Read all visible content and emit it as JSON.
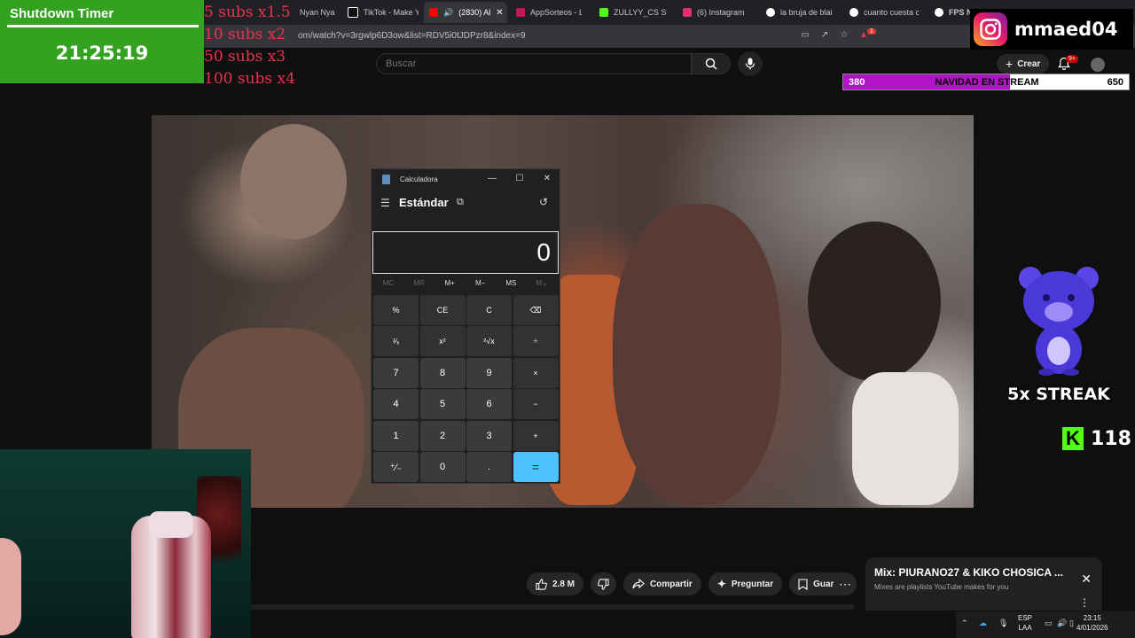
{
  "browser": {
    "tabs": [
      {
        "label": "Nyan Nya",
        "color": "#888888"
      },
      {
        "label": "TikTok - Make Yo",
        "color": "#ffffff"
      },
      {
        "label": "(2830) Al",
        "color": "#ff0000",
        "active": true
      },
      {
        "label": "AppSorteos - La",
        "color": "#c2185b"
      },
      {
        "label": "ZULLYY_CS Strea",
        "color": "#53fc18"
      },
      {
        "label": "(6) Instagram",
        "color": "#e1306c"
      },
      {
        "label": "la bruja de blair",
        "color": "#ffffff"
      },
      {
        "label": "cuanto cuesta cre",
        "color": "#ffffff"
      },
      {
        "label": "FPS NJA",
        "color": "#ffffff"
      }
    ],
    "url": "om/watch?v=3rgwlp6D3ow&list=RDV5i0tJDPzr8&index=9",
    "extension_badge": "1"
  },
  "youtube": {
    "search_placeholder": "Buscar",
    "create_label": "Crear",
    "notifications_badge": "9+",
    "actions": {
      "likes": "2.8 M",
      "share": "Compartir",
      "ask": "Preguntar",
      "save": "Guardar",
      "more": "⋯"
    },
    "mix_card": {
      "title": "Mix: PIURANO27 & KIKO CHOSICA ...",
      "subtitle": "Mixes are playlists YouTube makes for you"
    }
  },
  "calculator": {
    "title": "Calculadora",
    "mode": "Estándar",
    "display": "0",
    "memory": [
      "MC",
      "MR",
      "M+",
      "M−",
      "MS",
      "M⌄"
    ],
    "memory_dim": [
      true,
      true,
      false,
      false,
      false,
      true
    ],
    "keys": [
      [
        "%",
        "CE",
        "C",
        "⌫"
      ],
      [
        "¹⁄ₓ",
        "x²",
        "²√x",
        "÷"
      ],
      [
        "7",
        "8",
        "9",
        "×"
      ],
      [
        "4",
        "5",
        "6",
        "−"
      ],
      [
        "1",
        "2",
        "3",
        "+"
      ],
      [
        "⁺⁄₋",
        "0",
        ".",
        "="
      ]
    ]
  },
  "overlay": {
    "timer": {
      "title": "Shutdown Timer",
      "time": "21:25:19"
    },
    "subs_multipliers": [
      "5 subs x1.5",
      "10 subs x2",
      "50 subs x3",
      "100 subs x4"
    ],
    "instagram_handle": "mmaed04",
    "goal": {
      "current": "380",
      "title": "NAVIDAD EN STREAM",
      "target": "650",
      "progress": 0.585
    },
    "streak": "5x STREAK",
    "kick_followers": "118"
  },
  "taskbar": {
    "lang_top": "ESP",
    "lang_bottom": "LAA",
    "time": "23:15",
    "date": "4/01/2026"
  },
  "colors": {
    "timer_green": "#34a120",
    "subs_red": "#e8344f",
    "goal_fill": "#b414c8",
    "kick_green": "#53fc18",
    "calc_equals": "#4cc2ff"
  }
}
